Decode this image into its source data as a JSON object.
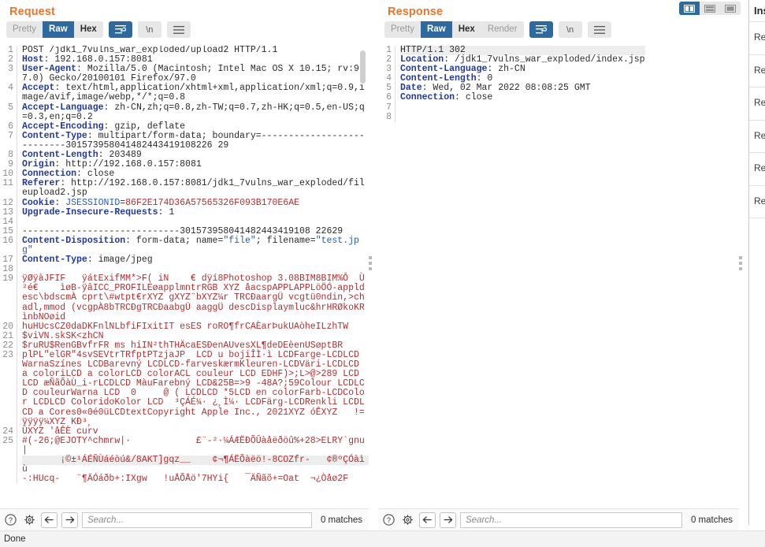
{
  "layout_toggle": {
    "options": [
      {
        "name": "split-vertical",
        "active": true
      },
      {
        "name": "split-horizontal",
        "active": false
      },
      {
        "name": "single-pane",
        "active": false
      }
    ]
  },
  "request": {
    "title": "Request",
    "toolbar": {
      "tabs": [
        {
          "label": "Pretty",
          "state": "off"
        },
        {
          "label": "Raw",
          "state": "on"
        },
        {
          "label": "Hex",
          "state": "enabled"
        }
      ],
      "wrap_icon": "word-wrap-icon",
      "wrap_active": true,
      "newline_label": "\\n",
      "menu_icon": "hamburger-menu-icon"
    },
    "line_count": 25,
    "lines": [
      {
        "n": "1",
        "parts": [
          {
            "t": "POST /jdk1_7vulns_war_exploded/upload2 HTTP/1.1",
            "c": "val"
          }
        ]
      },
      {
        "n": "2",
        "parts": [
          {
            "t": "Host",
            "c": "hdrname"
          },
          {
            "t": ": 192.168.0.157:8081",
            "c": "val"
          }
        ]
      },
      {
        "n": "3",
        "parts": [
          {
            "t": "User-Agent",
            "c": "hdrname"
          },
          {
            "t": ": Mozilla/5.0 (Macintosh; Intel Mac OS X 10.15; rv:97.0) Gecko/20100101 Firefox/97.0",
            "c": "val"
          }
        ]
      },
      {
        "n": "4",
        "parts": [
          {
            "t": "Accept",
            "c": "hdrname"
          },
          {
            "t": ": text/html,application/xhtml+xml,application/xml;q=0.9,image/avif,image/webp,*/*;q=0.8",
            "c": "val"
          }
        ]
      },
      {
        "n": "5",
        "parts": [
          {
            "t": "Accept-Language",
            "c": "hdrname"
          },
          {
            "t": ": zh-CN,zh;q=0.8,zh-TW;q=0.7,zh-HK;q=0.5,en-US;q=0.3,en;q=0.2",
            "c": "val"
          }
        ]
      },
      {
        "n": "6",
        "parts": [
          {
            "t": "Accept-Encoding",
            "c": "hdrname"
          },
          {
            "t": ": gzip, deflate",
            "c": "val"
          }
        ]
      },
      {
        "n": "7",
        "parts": [
          {
            "t": "Content-Type",
            "c": "hdrname"
          },
          {
            "t": ": multipart/form-data; boundary=---------------------------301573958041482443419108226 29",
            "c": "val"
          }
        ]
      },
      {
        "n": "8",
        "parts": [
          {
            "t": "Content-Length",
            "c": "hdrname"
          },
          {
            "t": ": 203489",
            "c": "val"
          }
        ]
      },
      {
        "n": "9",
        "parts": [
          {
            "t": "Origin",
            "c": "hdrname"
          },
          {
            "t": ": http://192.168.0.157:8081",
            "c": "val"
          }
        ]
      },
      {
        "n": "10",
        "parts": [
          {
            "t": "Connection",
            "c": "hdrname"
          },
          {
            "t": ": close",
            "c": "val"
          }
        ]
      },
      {
        "n": "11",
        "parts": [
          {
            "t": "Referer",
            "c": "hdrname"
          },
          {
            "t": ": http://192.168.0.157:8081/jdk1_7vulns_war_exploded/fileupload2.jsp",
            "c": "val"
          }
        ]
      },
      {
        "n": "12",
        "parts": [
          {
            "t": "Cookie",
            "c": "hdrname"
          },
          {
            "t": ": ",
            "c": "val"
          },
          {
            "t": "JSESSIONID",
            "c": "blue"
          },
          {
            "t": "=",
            "c": "val"
          },
          {
            "t": "86F2E174D36A57565326F093B170E6AE",
            "c": "red"
          }
        ]
      },
      {
        "n": "13",
        "parts": [
          {
            "t": "Upgrade-Insecure-Requests",
            "c": "hdrname"
          },
          {
            "t": ": 1",
            "c": "val"
          }
        ]
      },
      {
        "n": "14",
        "parts": [
          {
            "t": "",
            "c": "val"
          }
        ]
      },
      {
        "n": "15",
        "parts": [
          {
            "t": "-----------------------------301573958041482443419108 22629",
            "c": "val"
          }
        ]
      },
      {
        "n": "16",
        "parts": [
          {
            "t": "Content-Disposition",
            "c": "hdrname"
          },
          {
            "t": ": form-data; name=",
            "c": "val"
          },
          {
            "t": "\"file\"",
            "c": "blue"
          },
          {
            "t": "; filename=",
            "c": "val"
          },
          {
            "t": "\"test.jpg\"",
            "c": "blue"
          }
        ]
      },
      {
        "n": "17",
        "parts": [
          {
            "t": "Content-Type",
            "c": "hdrname"
          },
          {
            "t": ": image/jpeg",
            "c": "val"
          }
        ]
      },
      {
        "n": "18",
        "parts": [
          {
            "t": "",
            "c": "val"
          }
        ]
      },
      {
        "n": "19",
        "parts": [
          {
            "t": "ÿØÿàJFIF   ÿátExifMM*>F( iN    € dÿí8Photoshop 3.08BIM8BIM%Ô  Ù  ²é€    ìøB-ÿâICC_PROFILEøapplmntrRGB XYZ åacspAPPLAPPLöÖÓ-appldesc\\bdscmÀ cprt\\#wtpt€rXYZ gXYZ¨bXYZ¼r TRCÐaargÜ vcgtü0ndin,>chadl,mmod (vcgpÀ8bTRCÐgTRCÐaabgÜ aaggÜ descDisplaymluc&hrHRØkoKRìnbNOøid",
            "c": "red"
          }
        ]
      },
      {
        "n": "20",
        "parts": [
          {
            "t": "huHUcsCZ0daDKFnlNLbfiFIxitIT esES roRO¶frCAÈarÞukUAòheILzhTW",
            "c": "red"
          }
        ]
      },
      {
        "n": "21",
        "parts": [
          {
            "t": "$viVN.skSK<zhCN",
            "c": "red"
          }
        ]
      },
      {
        "n": "22",
        "parts": [
          {
            "t": "$ruRU$RenGBvfrFR ms hiIN²thTHÄcaESÐenAUvesXL¶deDEèenUSøptBR",
            "c": "red"
          }
        ]
      },
      {
        "n": "23",
        "parts": [
          {
            "t": "plPL\"elGR\"4svSEVtrTRfptPTzjaJP  LCD u bojiÎÌ·ì LCDFarge-LCDLCD WarnaSzínes LCDBarevný LCDLCD-farveskærmKleuren-LCDVäri-LCDLCD a coloriLCD a colorLCD colorACL couleur LCD EDHF)>;L>@>289 LCD LCD æÑãÕàÙ_i-rLCDLCD MàuFarebný LCD&25B=>9 -48A?;59Colour LCDLCD couleurWarna LCD  0     @ ( LCDLCD *5LCD en colorFarb-LCDColor LCDLCD ColoridoKolor LCD  ³ÇÁÉ¼· ¿¸Ì¼· LCDFärg-LCDRenkli LCDLCD a Cores0«0é0üLCDtextCopyright Apple Inc., 2021XYZ óÊXYZ   !=ÿÿÿÿ¼XYZ KÐ³¸",
            "c": "red"
          }
        ]
      },
      {
        "n": "24",
        "parts": [
          {
            "t": "ÚXYZ 'åÊÈ curv",
            "c": "red"
          }
        ]
      },
      {
        "n": "25",
        "parts": [
          {
            "t": "#(-26;@EJOTY^chmrw|·            £¨-²·¼ÁÆËÐÕÛàåëðöû%+28>ELRY`gnu|",
            "c": "red"
          }
        ]
      }
    ],
    "overflow_lines": [
      {
        "t": "       ¡©±¹ÁÉÑÙáéòú&/8AKT]gqz__    ¢¬¶ÁËÕàëö!-8COZfr-   ¢®ºÇÓàì",
        "c": "red",
        "hl": true
      },
      {
        "t": "ù",
        "c": "red",
        "hl": false
      },
      {
        "t": "-:HUcq-   ¨¶ÄÓáðb+:IXgw   !uÅÕÅö'7HYi{   ¯ÄÑãõ+=Oat  ¬¿Òåø2F",
        "c": "red",
        "hl": false
      }
    ],
    "find": {
      "help_icon": "help-icon",
      "settings_icon": "gear-icon",
      "prev_icon": "arrow-left-icon",
      "next_icon": "arrow-right-icon",
      "placeholder": "Search...",
      "value": "",
      "matches": "0 matches"
    }
  },
  "response": {
    "title": "Response",
    "toolbar": {
      "tabs": [
        {
          "label": "Pretty",
          "state": "off"
        },
        {
          "label": "Raw",
          "state": "on"
        },
        {
          "label": "Hex",
          "state": "enabled"
        },
        {
          "label": "Render",
          "state": "off"
        }
      ],
      "wrap_icon": "word-wrap-icon",
      "wrap_active": true,
      "newline_label": "\\n",
      "menu_icon": "hamburger-menu-icon"
    },
    "line_count": 8,
    "lines": [
      {
        "n": "1",
        "hl": true,
        "parts": [
          {
            "t": "HTTP/1.1 302",
            "c": "val"
          }
        ]
      },
      {
        "n": "2",
        "hl": false,
        "parts": [
          {
            "t": "Location",
            "c": "hdrname"
          },
          {
            "t": ": /jdk1_7vulns_war_exploded/index.jsp",
            "c": "val"
          }
        ]
      },
      {
        "n": "3",
        "hl": false,
        "parts": [
          {
            "t": "Content-Language",
            "c": "hdrname"
          },
          {
            "t": ": zh-CN",
            "c": "val"
          }
        ]
      },
      {
        "n": "4",
        "hl": false,
        "parts": [
          {
            "t": "Content-Length",
            "c": "hdrname"
          },
          {
            "t": ": 0",
            "c": "val"
          }
        ]
      },
      {
        "n": "5",
        "hl": false,
        "parts": [
          {
            "t": "Date",
            "c": "hdrname"
          },
          {
            "t": ": Wed, 02 Mar 2022 08:08:25 GMT",
            "c": "val"
          }
        ]
      },
      {
        "n": "6",
        "hl": false,
        "parts": [
          {
            "t": "Connection",
            "c": "hdrname"
          },
          {
            "t": ": close",
            "c": "val"
          }
        ]
      },
      {
        "n": "7",
        "hl": false,
        "parts": [
          {
            "t": "",
            "c": "val"
          }
        ]
      },
      {
        "n": "8",
        "hl": false,
        "parts": [
          {
            "t": "",
            "c": "val"
          }
        ]
      }
    ],
    "find": {
      "help_icon": "help-icon",
      "settings_icon": "gear-icon",
      "prev_icon": "arrow-left-icon",
      "next_icon": "arrow-right-icon",
      "placeholder": "Search...",
      "value": "",
      "matches": "0 matches"
    }
  },
  "inspector": {
    "title": "Inspector",
    "rows": [
      {
        "label": "Request attributes"
      },
      {
        "label": "Request query parameters"
      },
      {
        "label": "Request body parameters"
      },
      {
        "label": "Request cookies"
      },
      {
        "label": "Request headers"
      },
      {
        "label": "Response headers"
      }
    ]
  },
  "statusbar": {
    "text": "Done"
  },
  "colors": {
    "accent_orange": "#e8762c",
    "accent_blue": "#2c6aa0",
    "header_name": "#21399c",
    "binary_red": "#b03030",
    "cookie_value_red": "#b03030"
  }
}
